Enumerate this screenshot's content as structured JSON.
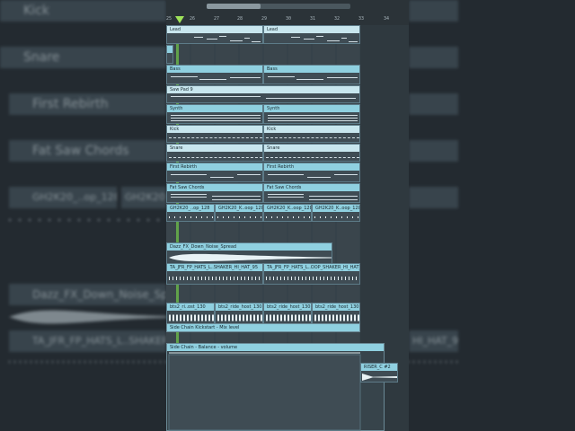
{
  "background": {
    "tracks": [
      {
        "label": "Kick"
      },
      {
        "label": "Snare"
      },
      {
        "label": "First Rebirth"
      },
      {
        "label": "Fat Saw Chords"
      },
      {
        "label": "GH2K20_..op_128"
      },
      {
        "label": "GH2K20_..op_128"
      },
      {
        "label": "Dazz_FX_Down_Noise_Sp"
      },
      {
        "label": "TA_JFR_FP_HATS_L..SHAKER"
      },
      {
        "label": "HI_HAT_95"
      }
    ]
  },
  "ruler": {
    "bars": [
      "25",
      "26",
      "27",
      "28",
      "29",
      "30",
      "31",
      "32",
      "33",
      "34"
    ]
  },
  "clips": {
    "lead_a": "Lead",
    "lead_b": "Lead",
    "bass_a": "Bass",
    "bass_b": "Bass",
    "sawpad": "Saw Pad 9",
    "synth_a": "Synth",
    "synth_b": "Synth",
    "kick_a": "Kick",
    "kick_b": "Kick",
    "snare_a": "Snare",
    "snare_b": "Snare",
    "rebirth_a": "First Rebirth",
    "rebirth_b": "First Rebirth",
    "fatsaw_a": "Fat Saw Chords",
    "fatsaw_b": "Fat Saw Chords",
    "gh_1": "GH2K20_..op_128",
    "gh_2": "GH2K20_K..oop_128",
    "gh_3": "GH2K20_K..oop_128",
    "gh_4": "GH2K20_K..oop_128",
    "dazz": "Dazz_FX_Down_Noise_Spread",
    "hats_a": "TA_JFR_FP_HATS_L..SHAKER_HI_HAT_95",
    "hats_b": "TA_JFR_FP_HATS_L..OOP_SHAKER_HI_HAT_95",
    "ride_1": "bts2_ri..ost_130",
    "ride_2": "bts2_ride_host_130",
    "ride_3": "bts2_ride_host_130",
    "ride_4": "bts2_ride_host_130",
    "sidechain_mix": "Side Chain Kickstart - Mix level",
    "sidechain_balance": "Side Chain - Balance - volume",
    "riser": "RISER_C #2"
  },
  "colors": {
    "clip_header": "#8fd0e0",
    "playhead": "#9fe35a",
    "panel_bg": "#3a454c"
  }
}
